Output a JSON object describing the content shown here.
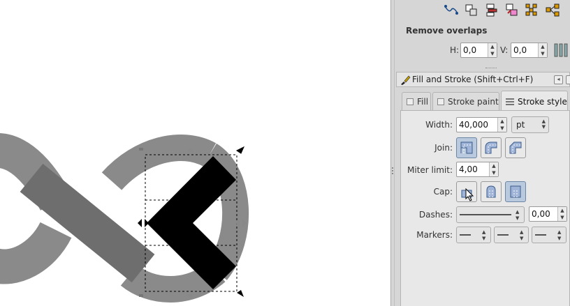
{
  "remove_overlaps": {
    "title": "Remove overlaps",
    "h_label": "H:",
    "h_value": "0,0",
    "v_label": "V:",
    "v_value": "0,0"
  },
  "dock": {
    "title": "Fill and Stroke (Shift+Ctrl+F)"
  },
  "tabs": [
    {
      "label": "Fill",
      "active": false
    },
    {
      "label": "Stroke paint",
      "active": false
    },
    {
      "label": "Stroke style",
      "active": true
    }
  ],
  "stroke_style": {
    "width_label": "Width:",
    "width_value": "40,000",
    "unit_value": "pt",
    "join_label": "Join:",
    "miter_label": "Miter limit:",
    "miter_value": "4,00",
    "cap_label": "Cap:",
    "dashes_label": "Dashes:",
    "dash_offset": "0,00",
    "markers_label": "Markers:"
  },
  "colors": {
    "panel_bg": "#d6d6d6",
    "pressed_button": "#b9c9de",
    "shape_light": "#8a8a8a",
    "shape_dark": "#6e6e6e",
    "selection": "#000000"
  },
  "icons": [
    "distribute-icon",
    "align-icon",
    "arrange-icon",
    "exchange-icon",
    "grid-icon",
    "connector-icon"
  ]
}
